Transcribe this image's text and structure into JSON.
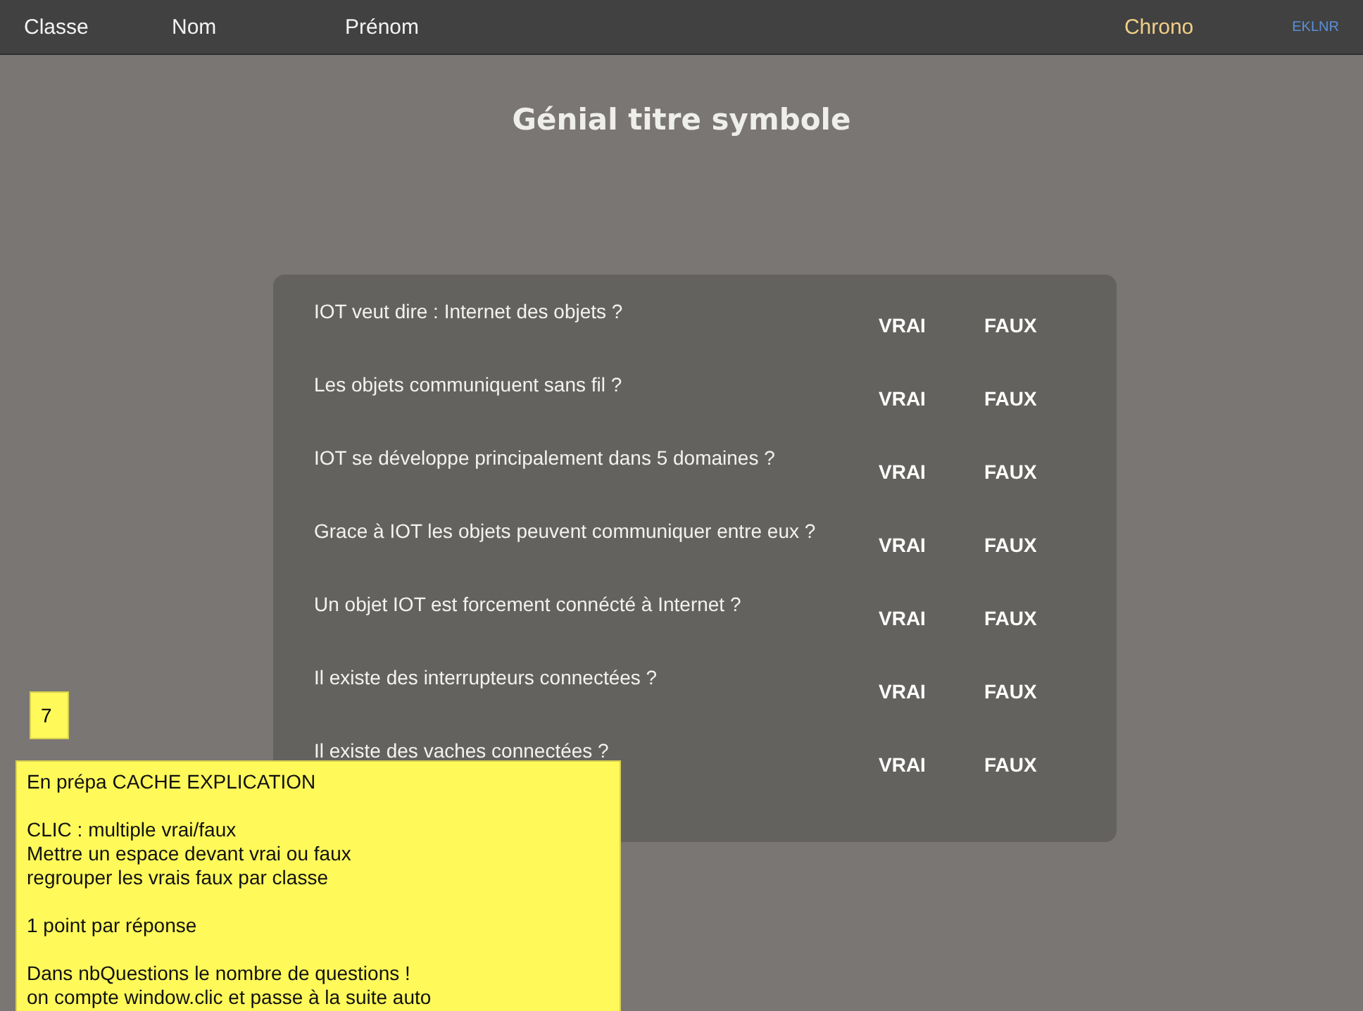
{
  "top_bar": {
    "columns": [
      "Classe",
      "Nom",
      "Prénom"
    ],
    "chrono": "Chrono",
    "code": "EKLNR"
  },
  "title": "Génial titre symbole",
  "questions": [
    {
      "text": "IOT veut dire  : Internet des objets ?",
      "true_label": "VRAI",
      "false_label": "FAUX"
    },
    {
      "text": "Les objets communiquent sans fil ?",
      "true_label": "VRAI",
      "false_label": "FAUX"
    },
    {
      "text": "IOT se développe principalement dans 5 domaines ?",
      "true_label": "VRAI",
      "false_label": "FAUX"
    },
    {
      "text": "Grace à IOT les objets peuvent communiquer entre eux ?",
      "true_label": "VRAI",
      "false_label": "FAUX"
    },
    {
      "text": "Un objet IOT est forcement connécté à Internet ?",
      "true_label": "VRAI",
      "false_label": "FAUX"
    },
    {
      "text": "Il existe des interrupteurs connectées ?",
      "true_label": "VRAI",
      "false_label": "FAUX"
    },
    {
      "text": "Il existe des vaches connectées ?",
      "true_label": "VRAI",
      "false_label": "FAUX"
    }
  ],
  "counter": "7",
  "note": [
    "En prépa CACHE EXPLICATION",
    "CLIC :  multiple vrai/faux\nMettre un espace devant vrai ou faux\nregrouper les vrais faux par classe",
    "1 point par réponse",
    "Dans nbQuestions le nombre de questions !\non compte window.clic et  passe à la suite auto"
  ]
}
